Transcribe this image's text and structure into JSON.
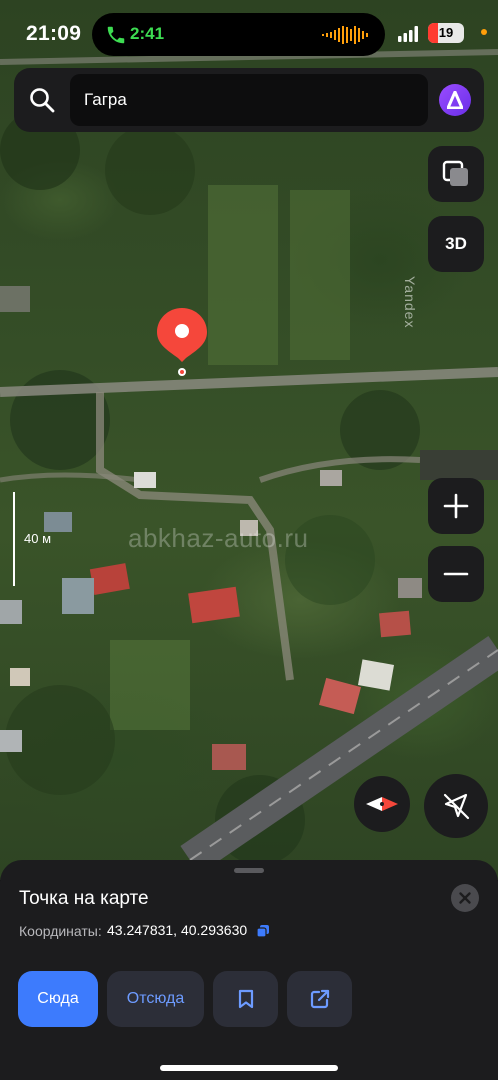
{
  "status_bar": {
    "time": "21:09",
    "call_duration": "2:41",
    "battery_level": "19",
    "battery_color": "#ff3b30",
    "call_color": "#3ddc52"
  },
  "search": {
    "query": "Гагра",
    "search_icon": "search-icon",
    "assistant_icon": "alice-icon"
  },
  "map": {
    "layers_icon": "layers-icon",
    "mode_3d_label": "3D",
    "zoom_in_icon": "plus-icon",
    "zoom_out_icon": "minus-icon",
    "compass_icon": "compass-icon",
    "location_icon": "location-off-icon",
    "provider_logo": "Yandex",
    "scale_label": "40 м",
    "watermark": "abkhaz-auto.ru"
  },
  "sheet": {
    "title": "Точка на карте",
    "coords_label": "Координаты:",
    "coords_value": "43.247831, 40.293630",
    "buttons": {
      "here": "Сюда",
      "from": "Отсюда"
    },
    "accent_color": "#3d7bfd"
  }
}
